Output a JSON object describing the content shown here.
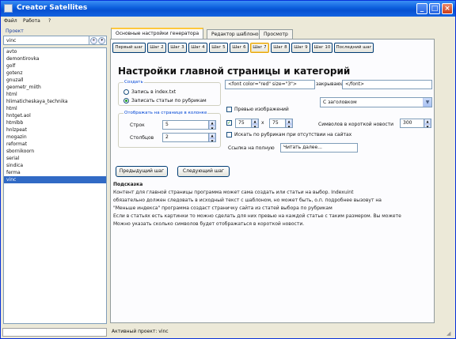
{
  "window": {
    "title": "Creator Satellites"
  },
  "menu": [
    "Файл",
    "Работа",
    "?"
  ],
  "project": {
    "label": "Проект",
    "current": "vinc",
    "list": [
      "avto",
      "demontirovka",
      "golf",
      "gotenz",
      "gnuzall",
      "geometr_miith",
      "html",
      "hlimaticheskaya_technika",
      "html",
      "hntget.aol",
      "htmlbb",
      "hnlzpeat",
      "mogazin",
      "reformat",
      "sbornikoorn",
      "serial",
      "sindica",
      "ferma",
      "vinc"
    ],
    "selected_index": 18
  },
  "tabs": [
    "Основные настройки генератора",
    "Редактор шаблонов",
    "Просмотр"
  ],
  "steps": [
    "Первый шаг",
    "Шаг 2",
    "Шаг 3",
    "Шаг 4",
    "Шаг 5",
    "Шаг 6",
    "Шаг 7",
    "Шаг 8",
    "Шаг 9",
    "Шаг 10",
    "Последний шаг"
  ],
  "current_step": 6,
  "heading": "Настройки главной страницы и категорий",
  "create_group": {
    "legend": "Создать",
    "opt1": "Запись в index.txt",
    "opt2": "Записать статьи по рубрикам"
  },
  "count_group": {
    "legend": "Отображать на странице в колонке",
    "rows_label": "Строк",
    "rows_value": "5",
    "cols_label": "Столбцов",
    "cols_value": "2"
  },
  "header_template": {
    "value": "<font color=\"red\" size=\"3\">",
    "closing_label": "закрывающий",
    "closing_value": "</font>"
  },
  "heading_select": {
    "value": "С заголовком"
  },
  "image_check": {
    "label": "Превью изображений"
  },
  "image_size": {
    "w": "75",
    "x": "x",
    "h": "75"
  },
  "short_count": {
    "label": "Символов в короткой новости",
    "value": "300"
  },
  "rubric_check": {
    "label": "Искать по рубрикам при отсутствии на сайтах"
  },
  "read_more": {
    "label": "Ссылка на полную",
    "value": "Читать далее..."
  },
  "buttons": {
    "prev": "Предыдущий шаг",
    "next": "Следующий шаг"
  },
  "hints": {
    "title": "Подсказка",
    "lines": [
      "Контент для главной страницы программа может сама создать или статьи на выбор. Indexuint",
      "обязательно должен следовать в исходный текст с шаблоном, но может быть, о.п. подробнее вызовут на",
      "\"Меньше индекса\" программа создаст страничку сайта из статей выбора по рубрикам",
      "Если в статьях есть картинки то можно сделать для них превью на каждой статье с таким размером. Вы можете",
      "Можно указать сколько символов будет отображаться в короткой новости."
    ]
  },
  "status": {
    "text": "Активный проект: vinc"
  }
}
